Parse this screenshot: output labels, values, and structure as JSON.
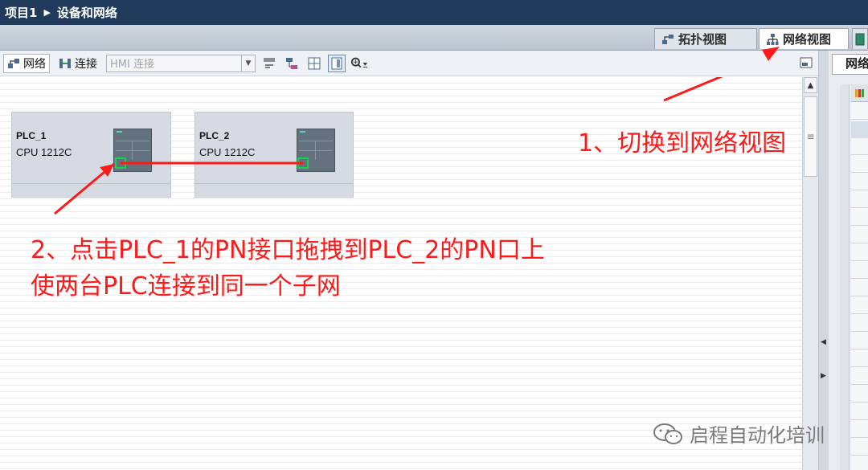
{
  "breadcrumb": {
    "project": "项目1",
    "page": "设备和网络"
  },
  "view_tabs": {
    "topology": "拓扑视图",
    "network": "网络视图"
  },
  "toolbar": {
    "network_button": "网络",
    "connections_button": "连接",
    "connection_type_value": "HMI 连接"
  },
  "devices": [
    {
      "name": "PLC_1",
      "cpu": "CPU 1212C"
    },
    {
      "name": "PLC_2",
      "cpu": "CPU 1212C"
    }
  ],
  "annotations": {
    "step1": "1、切换到网络视图",
    "step2_line1": "2、点击PLC_1的PN接口拖拽到PLC_2的PN口上",
    "step2_line2": "使两台PLC连接到同一个子网"
  },
  "right_panel": {
    "tab_label": "网络"
  },
  "watermark": "启程自动化培训",
  "colors": {
    "annotation": "#ff1a1a",
    "port_highlight": "#17d24b",
    "titlebar": "#1f3a5b"
  }
}
